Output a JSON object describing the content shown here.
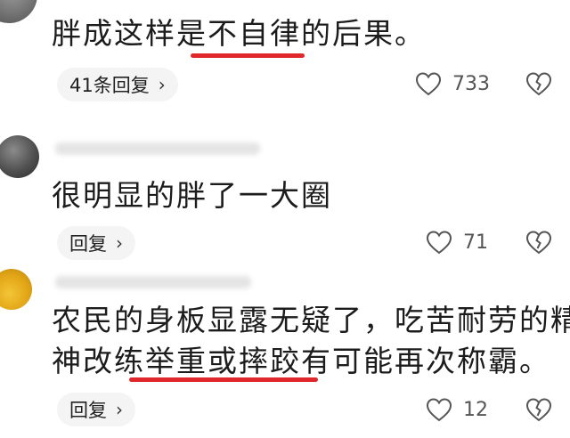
{
  "comments": [
    {
      "text": "胖成这样是不自律的后果。",
      "reply_label": "41条回复",
      "like_count": "733"
    },
    {
      "text": "很明显的胖了一大圈",
      "reply_label": "回复",
      "like_count": "71"
    },
    {
      "text_line1": "农民的身板显露无疑了，吃苦耐劳的精",
      "text_line2": "神改练举重或摔跤有可能再次称霸。",
      "reply_label": "回复",
      "like_count": "12"
    }
  ],
  "icons": {
    "like": "heart-outline-icon",
    "dislike": "broken-heart-icon",
    "chevron": "chevron-right-icon"
  },
  "colors": {
    "underline": "#e0282c",
    "pill_bg": "#f4f4f4",
    "text": "#1c1c1c",
    "muted": "#555555"
  }
}
